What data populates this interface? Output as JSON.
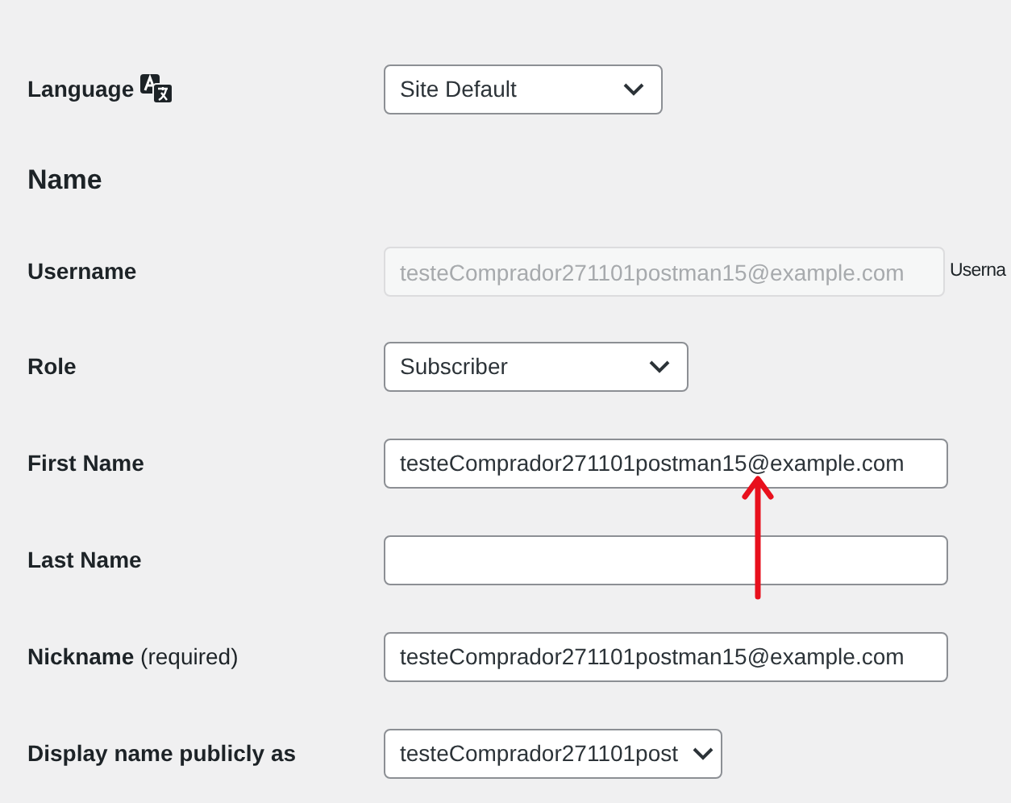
{
  "language": {
    "label": "Language",
    "value": "Site Default"
  },
  "section_heading": "Name",
  "fields": [
    {
      "kind": "disabled_input",
      "label": "Username",
      "value": "testeComprador271101postman15@example.com",
      "note": "Userna"
    },
    {
      "kind": "select",
      "label": "Role",
      "value": "Subscriber"
    },
    {
      "kind": "input",
      "label": "First Name",
      "value": "testeComprador271101postman15@example.com"
    },
    {
      "kind": "input",
      "label": "Last Name"
    },
    {
      "kind": "input",
      "label": "Nickname",
      "label_suffix": "(required)",
      "value": "testeComprador271101postman15@example.com"
    },
    {
      "kind": "narrow_select",
      "label": "Display name publicly as",
      "value": "testeComprador271101post"
    }
  ],
  "annotation": {
    "kind": "arrow",
    "color": "#e8101d"
  }
}
